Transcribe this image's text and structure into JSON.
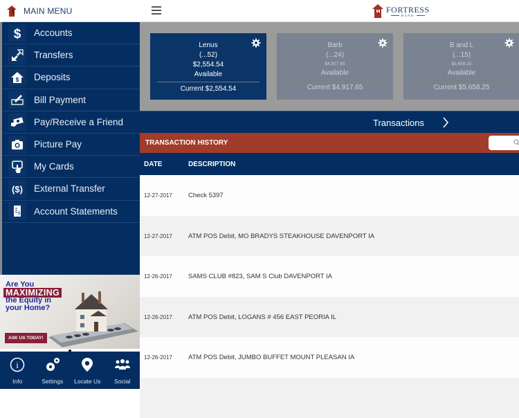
{
  "header": {
    "menu_label": "MAIN MENU",
    "brand_name": "FORTRESS",
    "brand_sub": "BANK",
    "colors": {
      "primary": "#042e62",
      "accent": "#a13b2a"
    }
  },
  "sidebar": {
    "items": [
      {
        "label": "Accounts",
        "icon": "dollar-icon"
      },
      {
        "label": "Transfers",
        "icon": "transfer-arrows-icon"
      },
      {
        "label": "Deposits",
        "icon": "house-dollar-icon"
      },
      {
        "label": "Bill Payment",
        "icon": "check-pen-icon"
      },
      {
        "label": "Pay/Receive a Friend",
        "icon": "money-hand-icon"
      },
      {
        "label": "Picture Pay",
        "icon": "camera-icon"
      },
      {
        "label": "My Cards",
        "icon": "card-tap-icon"
      },
      {
        "label": "External Transfer",
        "icon": "dollar-parens-icon"
      },
      {
        "label": "Account Statements",
        "icon": "statement-icon"
      }
    ]
  },
  "promo": {
    "line1": "Are You",
    "line2": "MAXIMIZING",
    "line3a": "the Equity in",
    "line3b": "your Home?",
    "cta": "ASK US TODAY!"
  },
  "bottom_nav": [
    {
      "label": "Info",
      "icon": "info-icon"
    },
    {
      "label": "Settings",
      "icon": "gears-icon"
    },
    {
      "label": "Locate Us",
      "icon": "location-pin-icon"
    },
    {
      "label": "Social",
      "icon": "people-icon"
    }
  ],
  "accounts": [
    {
      "name": "Lenus",
      "number": "(...52)",
      "available_amount": "$2,554.54",
      "available_label": "Available",
      "current": "Current $2,554.54",
      "active": true
    },
    {
      "name": "Barb",
      "number": "(...24)",
      "available_amount": "$4,917.65",
      "available_label": "Available",
      "current": "Current $4,917.65",
      "active": false
    },
    {
      "name": "B and L",
      "number": "(...15)",
      "available_amount": "$5,658.25",
      "available_label": "Available",
      "current": "Current $5,658.25",
      "active": false
    }
  ],
  "transactions_bar": {
    "label": "Transactions"
  },
  "history": {
    "title": "TRANSACTION HISTORY",
    "search_placeholder": "",
    "columns": {
      "date": "DATE",
      "description": "DESCRIPTION"
    },
    "rows": [
      {
        "date": "12-27-2017",
        "description": "Check 5397"
      },
      {
        "date": "12-27-2017",
        "description": "ATM POS Debit, MO BRADYS STEAKHOUSE DAVENPORT IA"
      },
      {
        "date": "12-26-2017",
        "description": "SAMS CLUB #823, SAM S Club DAVENPORT IA"
      },
      {
        "date": "12-26-2017",
        "description": "ATM POS Debit, LOGANS # 456 EAST PEORIA IL"
      },
      {
        "date": "12-26-2017",
        "description": "ATM POS Debit, JUMBO BUFFET MOUNT PLEASAN IA"
      },
      {
        "date": "",
        "description": ""
      }
    ]
  }
}
